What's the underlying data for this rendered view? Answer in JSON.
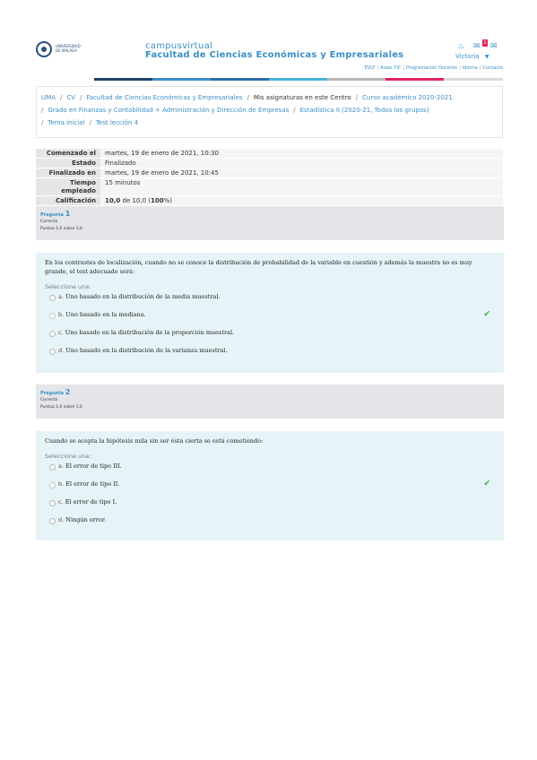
{
  "header": {
    "logo_text": "UNIVERSIDAD DE MÁLAGA",
    "site_sub": "campusvirtual",
    "site_title": "Facultad de Ciencias Económicas y Empresariales",
    "notif_count": "1",
    "user_name": "Victoria",
    "links": [
      "EVLT",
      "Aulas TIC",
      "Programación Docente",
      "Idioma",
      "Contacto"
    ],
    "bar_colors": [
      "#ffffff",
      "#1e3f66",
      "#3a8fc7",
      "#2d6ea8",
      "#46b4d4",
      "#b7b7b7",
      "#e0245e",
      "#d8d8d8"
    ],
    "icons": [
      "bell-icon",
      "chat-icon",
      "mail-icon",
      "caret-down-icon"
    ]
  },
  "breadcrumb": [
    {
      "label": "UMA",
      "link": true
    },
    {
      "label": "CV",
      "link": true
    },
    {
      "label": "Facultad de Ciencias Económicas y Empresariales",
      "link": true
    },
    {
      "label": "Mis asignaturas en este Centro",
      "link": false
    },
    {
      "label": "Curso académico 2020-2021",
      "link": true
    },
    {
      "label": "Grado en Finanzas y Contabilidad + Administración y Dirección de Empresas",
      "link": true
    },
    {
      "label": "Estadística II (2020-21, Todos los grupos)",
      "link": true
    },
    {
      "label": "Tema inicial",
      "link": true
    },
    {
      "label": "Test lección 4",
      "link": true
    }
  ],
  "summary": [
    {
      "label": "Comenzado el",
      "value": "martes, 19 de enero de 2021, 10:30"
    },
    {
      "label": "Estado",
      "value": "Finalizado"
    },
    {
      "label": "Finalizado en",
      "value": "martes, 19 de enero de 2021, 10:45"
    },
    {
      "label": "Tiempo empleado",
      "value": "15 minutos"
    },
    {
      "label": "Calificación",
      "value_bold": "10,0",
      "value_mid": " de 10,0 (",
      "value_pct": "100",
      "value_end": "%)"
    }
  ],
  "questions": [
    {
      "label": "Pregunta",
      "number": "1",
      "status": "Correcta",
      "score": "Puntúa 1,0 sobre 1,0",
      "text": "En los contrastes de localización, cuando no se conoce la distribución de probabilidad de la variable en cuestión y además la muestra no es muy grande, el test adecuado será:",
      "prompt": "Seleccione una:",
      "options": [
        {
          "letter": "a.",
          "text": "Uno basado en la distribución de la media muestral.",
          "checked": false,
          "correct": false
        },
        {
          "letter": "b.",
          "text": "Uno basado en la mediana.",
          "checked": true,
          "correct": true
        },
        {
          "letter": "c.",
          "text": "Uno basado en la distribución de la proporción muestral.",
          "checked": false,
          "correct": false
        },
        {
          "letter": "d.",
          "text": "Uno basado en la distribución de la varianza muestral.",
          "checked": false,
          "correct": false
        }
      ]
    },
    {
      "label": "Pregunta",
      "number": "2",
      "status": "Correcta",
      "score": "Puntúa 1,0 sobre 1,0",
      "text": "Cuando se acepta la hipótesis nula sin ser ésta cierta se está cometiendo:",
      "prompt": "Seleccione una:",
      "options": [
        {
          "letter": "a.",
          "text": "El error de tipo III.",
          "checked": false,
          "correct": false
        },
        {
          "letter": "b.",
          "text": "El error de tipo II.",
          "checked": true,
          "correct": true
        },
        {
          "letter": "c.",
          "text": "El error de tipo I.",
          "checked": false,
          "correct": false
        },
        {
          "letter": "d.",
          "text": "Ningún error.",
          "checked": false,
          "correct": false
        }
      ]
    }
  ]
}
